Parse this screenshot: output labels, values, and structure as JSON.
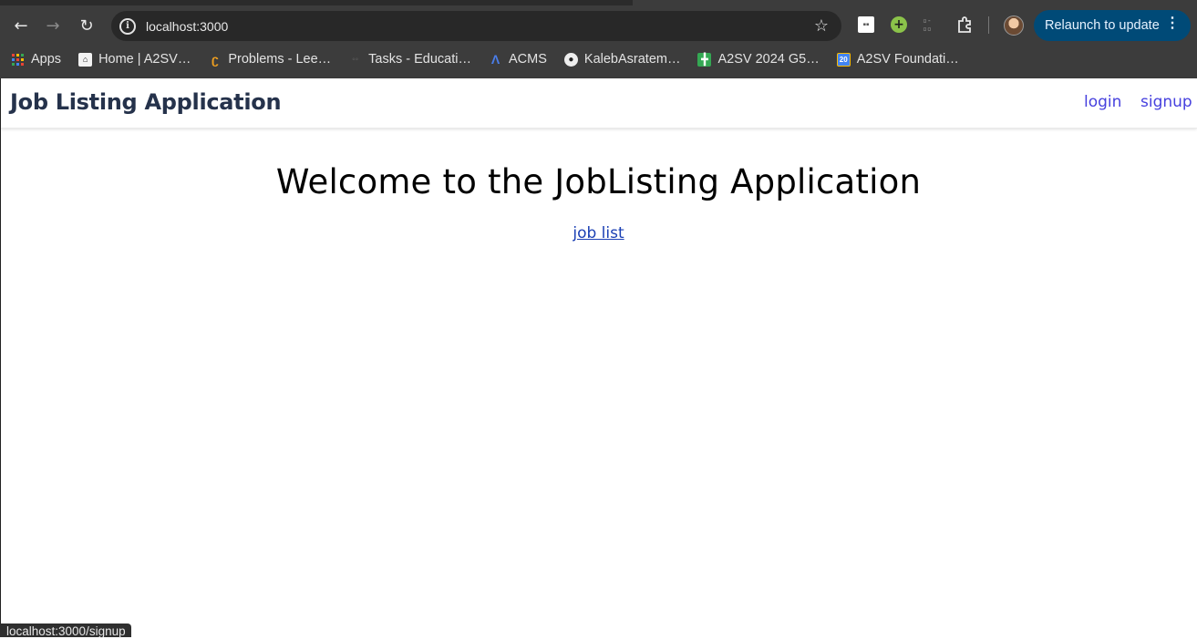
{
  "browser": {
    "url": "localhost:3000",
    "relaunch_label": "Relaunch to update",
    "status_url": "localhost:3000/signup",
    "bookmarks": [
      {
        "label": "Apps",
        "icon": "apps-grid-icon"
      },
      {
        "label": "Home | A2SV…",
        "icon": "home-favicon"
      },
      {
        "label": "Problems - Lee…",
        "icon": "leetcode-icon"
      },
      {
        "label": "Tasks - Educati…",
        "icon": "tasks-favicon"
      },
      {
        "label": "ACMS",
        "icon": "acms-icon"
      },
      {
        "label": "KalebAsratem…",
        "icon": "github-icon"
      },
      {
        "label": "A2SV 2024 G5…",
        "icon": "sheets-icon"
      },
      {
        "label": "A2SV Foundati…",
        "icon": "calendar-icon"
      }
    ]
  },
  "app": {
    "brand": "Job Listing Application",
    "nav": {
      "login": "login",
      "signup": "signup"
    },
    "heading": "Welcome to the JobListing Application",
    "job_list_link": "job list"
  },
  "colors": {
    "brand_text": "#25324b",
    "nav_link": "#4640de",
    "relaunch_bg": "#004a77"
  }
}
